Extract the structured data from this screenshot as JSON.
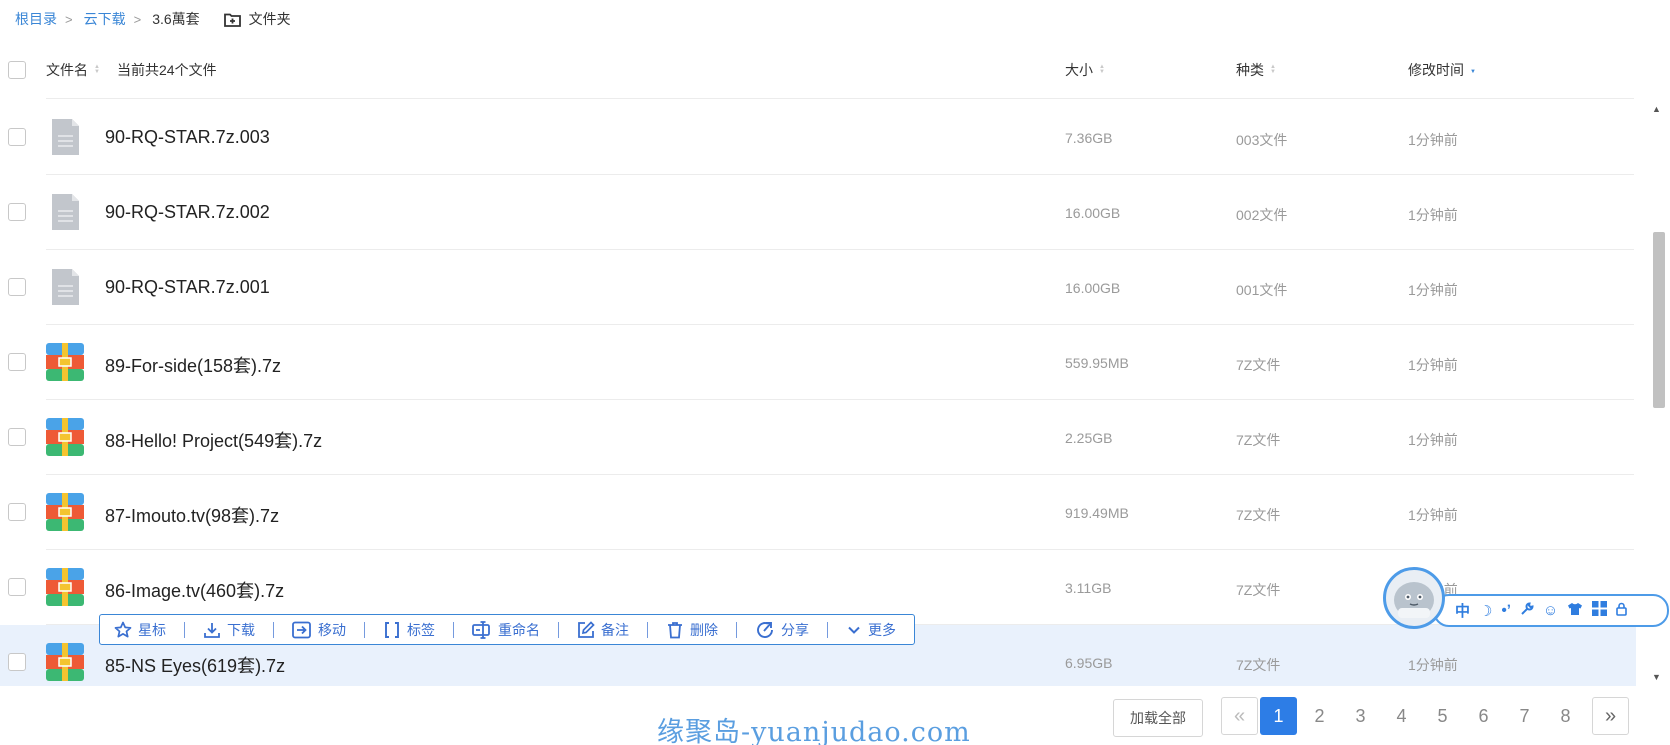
{
  "breadcrumb": {
    "items": [
      "根目录",
      "云下载"
    ],
    "current": "3.6萬套",
    "new_folder_label": "文件夹"
  },
  "header": {
    "name_label": "文件名",
    "count_label": "当前共24个文件",
    "size_label": "大小",
    "kind_label": "种类",
    "time_label": "修改时间"
  },
  "files": [
    {
      "name": "90-RQ-STAR.7z.003",
      "size": "7.36GB",
      "kind": "003文件",
      "time": "1分钟前",
      "icon": "generic-file-icon"
    },
    {
      "name": "90-RQ-STAR.7z.002",
      "size": "16.00GB",
      "kind": "002文件",
      "time": "1分钟前",
      "icon": "generic-file-icon"
    },
    {
      "name": "90-RQ-STAR.7z.001",
      "size": "16.00GB",
      "kind": "001文件",
      "time": "1分钟前",
      "icon": "generic-file-icon"
    },
    {
      "name": "89-For-side(158套).7z",
      "size": "559.95MB",
      "kind": "7Z文件",
      "time": "1分钟前",
      "icon": "archive-file-icon"
    },
    {
      "name": "88-Hello! Project(549套).7z",
      "size": "2.25GB",
      "kind": "7Z文件",
      "time": "1分钟前",
      "icon": "archive-file-icon"
    },
    {
      "name": "87-Imouto.tv(98套).7z",
      "size": "919.49MB",
      "kind": "7Z文件",
      "time": "1分钟前",
      "icon": "archive-file-icon"
    },
    {
      "name": "86-Image.tv(460套).7z",
      "size": "3.11GB",
      "kind": "7Z文件",
      "time": "1分钟前",
      "icon": "archive-file-icon"
    },
    {
      "name": "85-NS Eyes(619套).7z",
      "size": "6.95GB",
      "kind": "7Z文件",
      "time": "1分钟前",
      "icon": "archive-file-icon"
    }
  ],
  "toolbar": {
    "star": "星标",
    "download": "下载",
    "move": "移动",
    "tag": "标签",
    "rename": "重命名",
    "note": "备注",
    "delete": "删除",
    "share": "分享",
    "more": "更多"
  },
  "widget": {
    "lang": "中"
  },
  "watermark": "缘聚岛-yuanjudao.com",
  "pagination": {
    "load_all": "加载全部",
    "prev": "«",
    "next": "»",
    "pages": [
      "1",
      "2",
      "3",
      "4",
      "5",
      "6",
      "7",
      "8"
    ],
    "current": "1"
  },
  "colors": {
    "accent": "#2d7de6",
    "link": "#3a86d6",
    "selected_row": "#e9f1fc"
  }
}
